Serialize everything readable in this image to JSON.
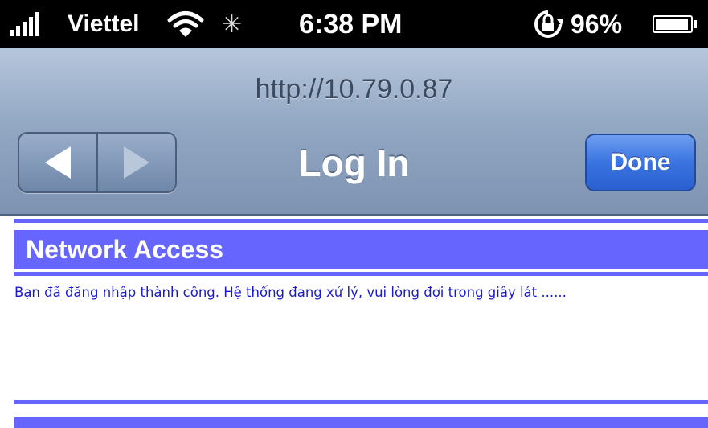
{
  "status_bar": {
    "carrier": "Viettel",
    "time": "6:38 PM",
    "battery_percent": "96%",
    "battery_level": 0.96,
    "icons": [
      "signal-bars-icon",
      "wifi-icon",
      "activity-spinner-icon",
      "rotation-lock-icon",
      "battery-icon"
    ]
  },
  "nav": {
    "url": "http://10.79.0.87",
    "title": "Log In",
    "done_label": "Done",
    "back_enabled": true,
    "forward_enabled": false
  },
  "page": {
    "heading": "Network Access",
    "message": "Bạn đã đăng nhập thành công. Hệ thống đang xử lý, vui lòng đợi trong giây lát ......"
  },
  "colors": {
    "accent": "#6666ff",
    "message_text": "#1a1acc",
    "done_button": "#3a74e0",
    "navbar": "#93a8c3"
  }
}
